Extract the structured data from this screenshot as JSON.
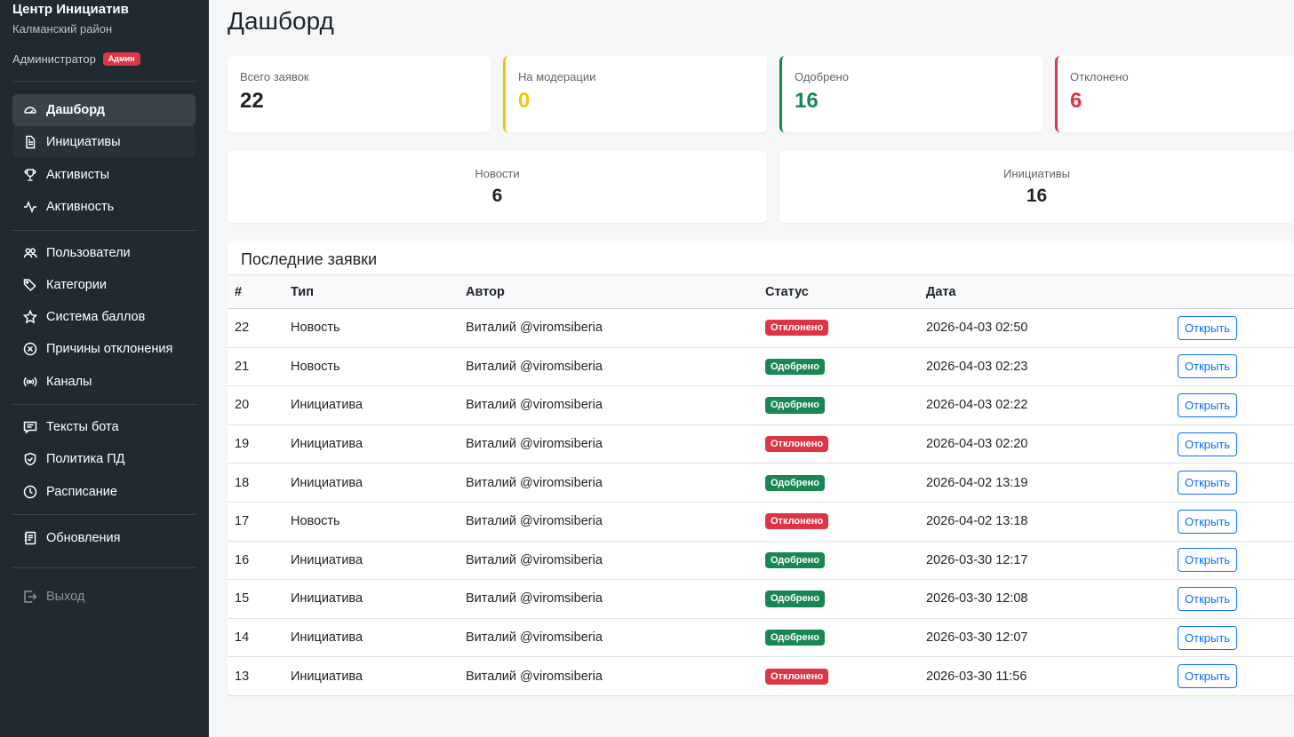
{
  "sidebar": {
    "brand_title": "Центр Инициатив",
    "brand_subtitle": "Калманский район",
    "user_role": "Администратор",
    "role_badge": "Админ",
    "items": [
      {
        "label": "Дашборд",
        "icon": "speedometer-icon"
      },
      {
        "label": "Инициативы",
        "icon": "file-text-icon"
      },
      {
        "label": "Активисты",
        "icon": "trophy-icon"
      },
      {
        "label": "Активность",
        "icon": "activity-icon"
      },
      {
        "label": "Пользователи",
        "icon": "people-icon"
      },
      {
        "label": "Категории",
        "icon": "tags-icon"
      },
      {
        "label": "Система баллов",
        "icon": "star-icon"
      },
      {
        "label": "Причины отклонения",
        "icon": "x-circle-icon"
      },
      {
        "label": "Каналы",
        "icon": "broadcast-icon"
      },
      {
        "label": "Тексты бота",
        "icon": "chat-text-icon"
      },
      {
        "label": "Политика ПД",
        "icon": "shield-check-icon"
      },
      {
        "label": "Расписание",
        "icon": "clock-icon"
      },
      {
        "label": "Обновления",
        "icon": "journal-text-icon"
      },
      {
        "label": "Выход",
        "icon": "logout-icon"
      }
    ]
  },
  "main": {
    "title": "Дашборд",
    "stats": [
      {
        "label": "Всего заявок",
        "value": "22",
        "color": "#212529"
      },
      {
        "label": "На модерации",
        "value": "0",
        "color": "#f0c419"
      },
      {
        "label": "Одобрено",
        "value": "16",
        "color": "#198754"
      },
      {
        "label": "Отклонено",
        "value": "6",
        "color": "#dc3545"
      }
    ],
    "mini": [
      {
        "label": "Новости",
        "value": "6"
      },
      {
        "label": "Инициативы",
        "value": "16"
      }
    ],
    "recent": {
      "title": "Последние заявки",
      "headers": [
        "#",
        "Тип",
        "Автор",
        "Статус",
        "Дата"
      ],
      "action_label": "Открыть",
      "rows": [
        {
          "id": "22",
          "type": "Новость",
          "author": "Виталий @viromsiberia",
          "status": "Отклонено",
          "status_color": "#dc3545",
          "date": "2026-04-03 02:50"
        },
        {
          "id": "21",
          "type": "Новость",
          "author": "Виталий @viromsiberia",
          "status": "Одобрено",
          "status_color": "#198754",
          "date": "2026-04-03 02:23"
        },
        {
          "id": "20",
          "type": "Инициатива",
          "author": "Виталий @viromsiberia",
          "status": "Одобрено",
          "status_color": "#198754",
          "date": "2026-04-03 02:22"
        },
        {
          "id": "19",
          "type": "Инициатива",
          "author": "Виталий @viromsiberia",
          "status": "Отклонено",
          "status_color": "#dc3545",
          "date": "2026-04-03 02:20"
        },
        {
          "id": "18",
          "type": "Инициатива",
          "author": "Виталий @viromsiberia",
          "status": "Одобрено",
          "status_color": "#198754",
          "date": "2026-04-02 13:19"
        },
        {
          "id": "17",
          "type": "Новость",
          "author": "Виталий @viromsiberia",
          "status": "Отклонено",
          "status_color": "#dc3545",
          "date": "2026-04-02 13:18"
        },
        {
          "id": "16",
          "type": "Инициатива",
          "author": "Виталий @viromsiberia",
          "status": "Одобрено",
          "status_color": "#198754",
          "date": "2026-03-30 12:17"
        },
        {
          "id": "15",
          "type": "Инициатива",
          "author": "Виталий @viromsiberia",
          "status": "Одобрено",
          "status_color": "#198754",
          "date": "2026-03-30 12:08"
        },
        {
          "id": "14",
          "type": "Инициатива",
          "author": "Виталий @viromsiberia",
          "status": "Одобрено",
          "status_color": "#198754",
          "date": "2026-03-30 12:07"
        },
        {
          "id": "13",
          "type": "Инициатива",
          "author": "Виталий @viromsiberia",
          "status": "Отклонено",
          "status_color": "#dc3545",
          "date": "2026-03-30 11:56"
        }
      ]
    }
  }
}
